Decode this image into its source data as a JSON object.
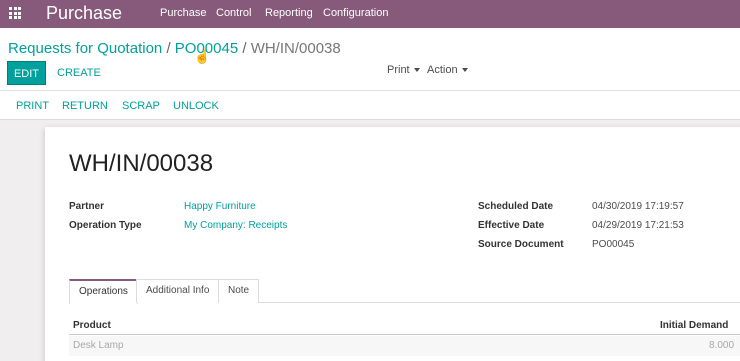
{
  "navbar": {
    "app_title": "Purchase",
    "menu": [
      "Purchase",
      "Control",
      "Reporting",
      "Configuration"
    ]
  },
  "breadcrumb": {
    "items": [
      "Requests for Quotation",
      "PO00045",
      "WH/IN/00038"
    ],
    "separator": "/"
  },
  "control": {
    "edit_label": "EDIT",
    "create_label": "CREATE",
    "print_label": "Print",
    "action_label": "Action"
  },
  "statusbar": {
    "buttons": [
      "PRINT",
      "RETURN",
      "SCRAP",
      "UNLOCK"
    ]
  },
  "record": {
    "title": "WH/IN/00038",
    "fields_left": [
      {
        "label": "Partner",
        "value": "Happy Furniture"
      },
      {
        "label": "Operation Type",
        "value": "My Company: Receipts"
      }
    ],
    "fields_right": [
      {
        "label": "Scheduled Date",
        "value": "04/30/2019 17:19:57"
      },
      {
        "label": "Effective Date",
        "value": "04/29/2019 17:21:53"
      },
      {
        "label": "Source Document",
        "value": "PO00045"
      }
    ]
  },
  "tabs": [
    "Operations",
    "Additional Info",
    "Note"
  ],
  "table": {
    "columns": [
      "Product",
      "Initial Demand"
    ],
    "rows": [
      {
        "product": "Desk Lamp",
        "initial_demand": "8.000"
      }
    ]
  },
  "colors": {
    "brand": "#875a7b",
    "accent": "#00a09d"
  }
}
